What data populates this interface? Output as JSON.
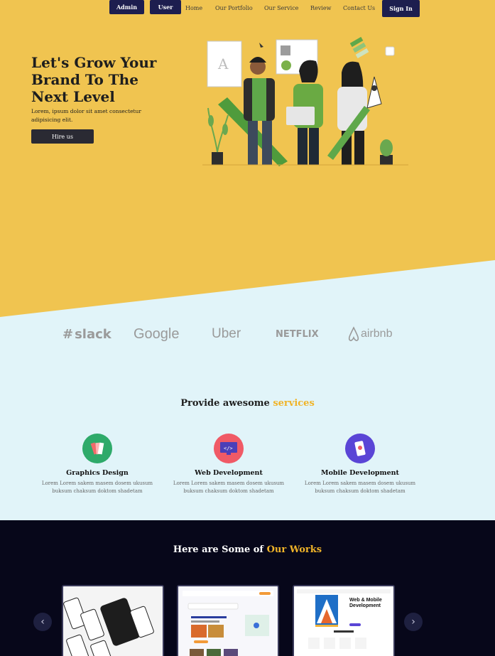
{
  "nav": {
    "admin_label": "Admin",
    "user_label": "User",
    "links": [
      "Home",
      "Our Portfolio",
      "Our Service",
      "Review",
      "Contact Us"
    ],
    "signin_label": "Sign In"
  },
  "hero": {
    "title": "Let's Grow Your Brand To The Next Level",
    "subtitle": "Lorem, ipsum dolor sit amet consectetur adipisicing elit.",
    "cta_label": "Hire us"
  },
  "logos": [
    "slack",
    "Google",
    "Uber",
    "NETFLIX",
    "airbnb"
  ],
  "services": {
    "title_main": "Provide awesome",
    "title_accent": "services",
    "items": [
      {
        "title": "Graphics Design",
        "desc": "Lorem Lorem sakem masem dosem ukusum buksum chaksum doktom shadetam",
        "icon": "palette-icon"
      },
      {
        "title": "Web Development",
        "desc": "Lorem Lorem sakem masem dosem ukusum buksum chaksum doktom shadetam",
        "icon": "monitor-code-icon"
      },
      {
        "title": "Mobile Development",
        "desc": "Lorem Lorem sakem masem dosem ukusum buksum chaksum doktom shadetam",
        "icon": "mobile-icon"
      }
    ]
  },
  "works": {
    "title_main": "Here are Some of",
    "title_accent": "Our Works",
    "cards": [
      {
        "text": ""
      },
      {
        "text": ""
      },
      {
        "text": "Web & Mobile Development"
      }
    ]
  },
  "colors": {
    "hero_bg": "#f0c450",
    "light_bg": "#e1f4f9",
    "dark_bg": "#07071a",
    "accent": "#f0b429",
    "nav_button": "#1d1e4f"
  }
}
